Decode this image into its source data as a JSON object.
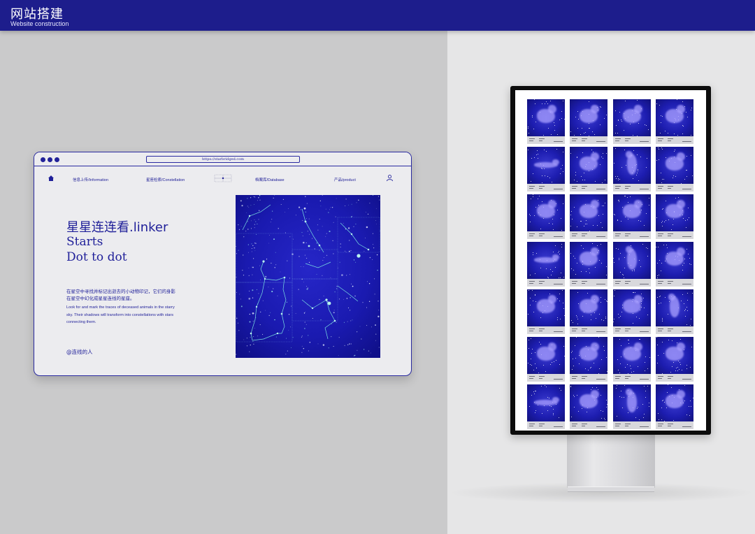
{
  "header": {
    "title": "网站搭建",
    "subtitle": "Website construction",
    "bg_color": "#1d1d8c"
  },
  "browser": {
    "url": "https://starbridged.com",
    "window_buttons": [
      "dot",
      "dot",
      "dot"
    ],
    "nav": {
      "home_icon": "home-icon",
      "items": [
        "信息上传/Information",
        "星座检索/Constellation",
        "档案库/Database",
        "产品/product"
      ],
      "user_icon": "user-icon"
    },
    "hero": {
      "title_cn": "星星连连看.linker",
      "title_en_line1": "Starts",
      "title_en_line2": "Dot to dot"
    },
    "description_cn": "在星空中寻找并标记出逝去的小动物印记，它们的身影在星空中幻化成星星连线的星座。",
    "description_en": "Look for and mark the traces of deceased animals in the starry sky. Their shadows will transform into constellations with stars connecting them.",
    "author": "@连线的人",
    "accent_color": "#1f1f99",
    "map_color": "#1c1cb8"
  },
  "monitor": {
    "grid_cols": 4,
    "grid_rows": 7,
    "cards": [
      "cat",
      "cat",
      "cat",
      "cat",
      "lizard",
      "cat",
      "dog",
      "cat",
      "cat",
      "cat",
      "cat",
      "cat",
      "lizard",
      "cat",
      "dog",
      "cat",
      "cat",
      "cat",
      "cat",
      "dog",
      "cat",
      "cat",
      "cat",
      "cat",
      "lizard",
      "cat",
      "dog",
      "cat"
    ]
  }
}
